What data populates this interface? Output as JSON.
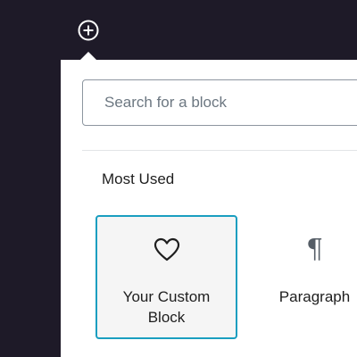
{
  "inserter": {
    "search": {
      "placeholder": "Search for a block",
      "value": ""
    },
    "section_title": "Most Used",
    "blocks": [
      {
        "label": "Your Custom Block",
        "icon": "heart-icon",
        "selected": true
      },
      {
        "label": "Paragraph",
        "icon": "paragraph-icon",
        "glyph": "¶",
        "selected": false
      }
    ]
  },
  "toolbar": {
    "add_button_icon": "plus-circle-icon"
  },
  "colors": {
    "background": "#1e1a28",
    "panel": "#ffffff",
    "selected_border": "#1a9ec0",
    "selected_fill": "#f5f5f5",
    "text": "#1e1e1e",
    "placeholder": "#6c7781"
  }
}
